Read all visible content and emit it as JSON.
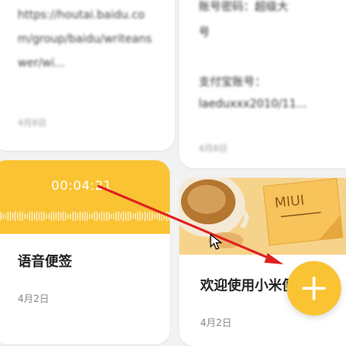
{
  "notes": [
    {
      "id": "note-url",
      "text": "https://houtai.baidu.com/group/baidu/writeanswer/wi...",
      "date": "4月8日"
    },
    {
      "id": "note-account",
      "lines": [
        "账号密码：超级大",
        "号",
        "支付宝账号：",
        "laeduxxx2010/11..."
      ],
      "date": "4月8日"
    },
    {
      "id": "note-voice",
      "type": "voice",
      "duration": "00:04:21",
      "title": "语音便签",
      "date": "4月2日",
      "accent_color": "#f9c333"
    },
    {
      "id": "note-welcome",
      "banner_label": "MIUI",
      "title": "欢迎使用小米便签",
      "date": "4月2日"
    }
  ],
  "fab": {
    "icon": "plus-icon",
    "color": "#f9c333"
  },
  "annotation": {
    "icon": "red-arrow",
    "color": "#e02020"
  }
}
